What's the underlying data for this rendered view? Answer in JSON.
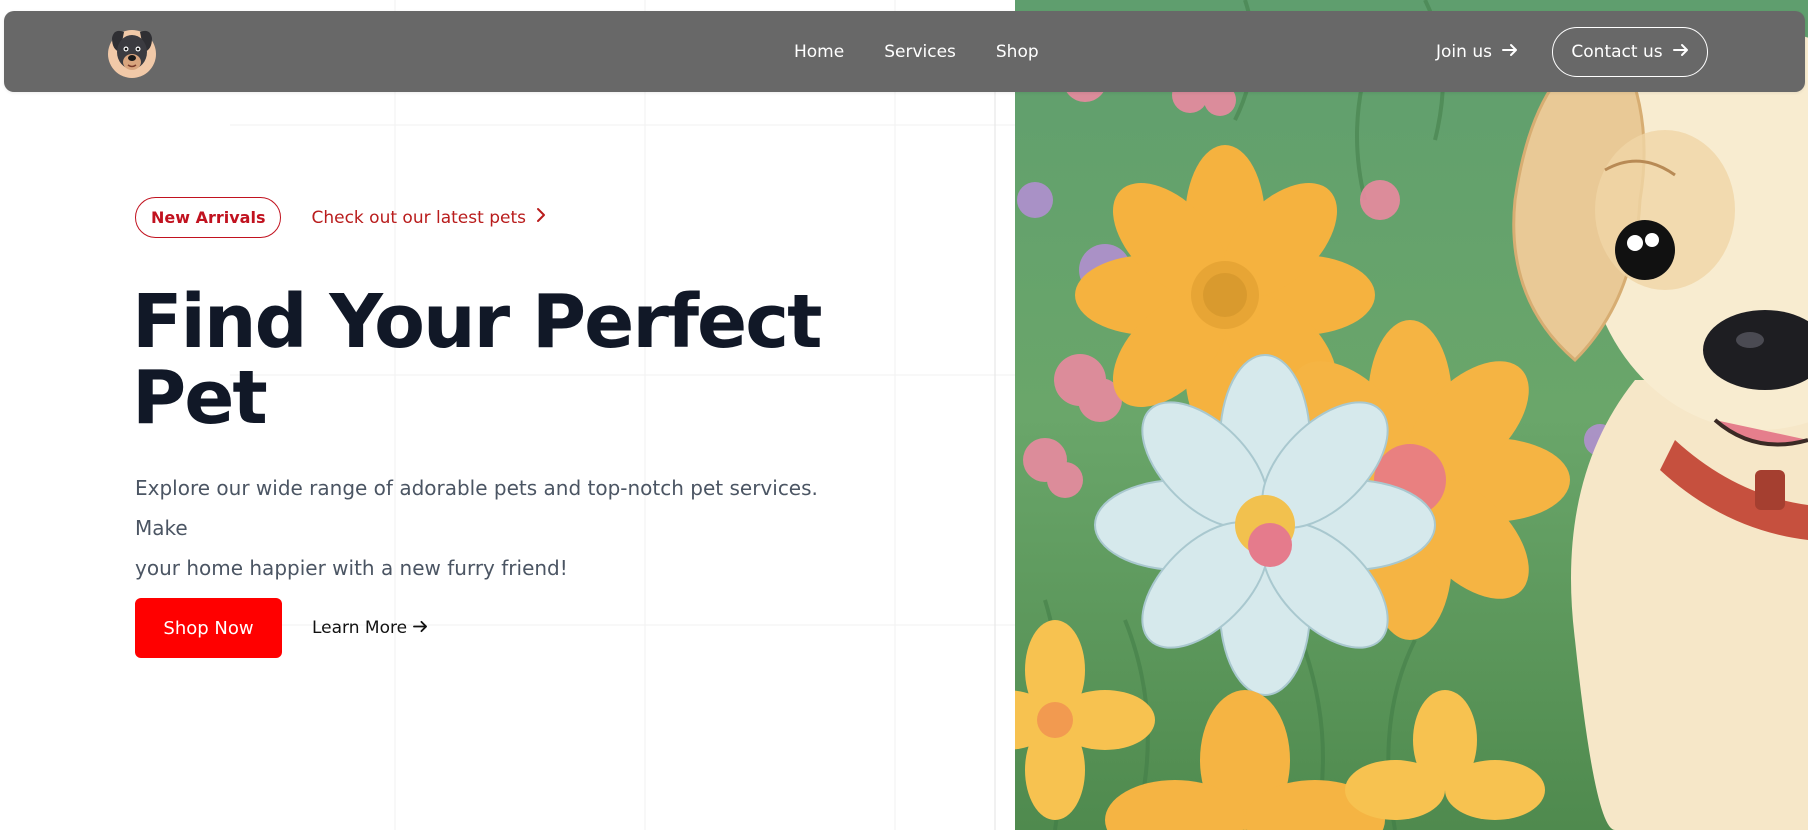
{
  "colors": {
    "nav_background": "#686868",
    "accent_red": "#ff0000",
    "badge_red": "#c1121f",
    "heading": "#111827",
    "body_text": "#4b5563",
    "background": "#ffffff"
  },
  "nav": {
    "logo_icon": "dog-logo-icon",
    "links": [
      {
        "label": "Home"
      },
      {
        "label": "Services"
      },
      {
        "label": "Shop"
      }
    ],
    "join_label": "Join us",
    "contact_label": "Contact us",
    "arrow_icon": "arrow-right-icon"
  },
  "hero": {
    "badge": "New Arrivals",
    "badge_link": "Check out our latest pets",
    "badge_link_icon": "chevron-right-icon",
    "title_line1": "Find Your Perfect",
    "title_line2": "Pet",
    "description_line1": "Explore our wide range of adorable pets and top-notch pet services. Make",
    "description_line2": "your home happier with a new furry friend!",
    "primary_button": "Shop Now",
    "secondary_button": "Learn More",
    "image_icon": "puppy-in-flowers-illustration"
  }
}
